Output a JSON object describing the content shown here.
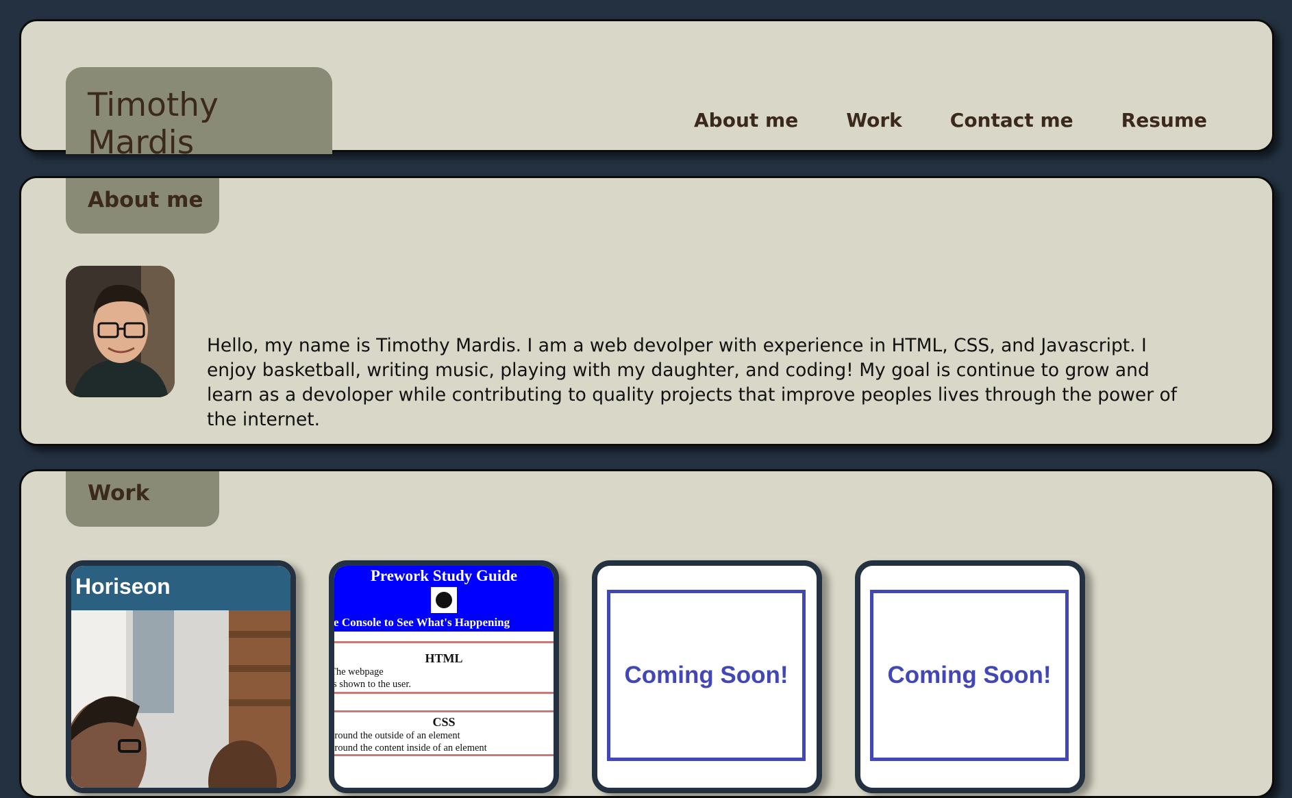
{
  "header": {
    "name": "Timothy Mardis",
    "nav": [
      "About me",
      "Work",
      "Contact me",
      "Resume"
    ]
  },
  "about": {
    "heading": "About me",
    "text": "Hello, my name is Timothy Mardis. I am a web devolper with experience in HTML, CSS, and Javascript. I enjoy basketball, writing music, playing with my daughter, and coding! My goal is continue to grow and learn as a devoloper while contributing to quality projects that improve peoples lives through the power of the internet."
  },
  "work": {
    "heading": "Work",
    "projects": [
      {
        "title": "Horiseon"
      },
      {
        "title": "Prework Study Guide",
        "subtitle": "Open the Console to See What's Happening",
        "sections": [
          {
            "heading": "HTML",
            "lines": [
              "The webpage",
              "is shown to the user."
            ]
          },
          {
            "heading": "CSS",
            "lines": [
              "around the outside of an element",
              "around the content inside of an element"
            ]
          }
        ]
      },
      {
        "label": "Coming Soon!"
      },
      {
        "label": "Coming Soon!"
      }
    ]
  },
  "colors": {
    "background": "#233140",
    "panel": "#d9d7c7",
    "tab": "#8a8b76",
    "text": "#3b2a1c",
    "accent": "#4147b6"
  }
}
